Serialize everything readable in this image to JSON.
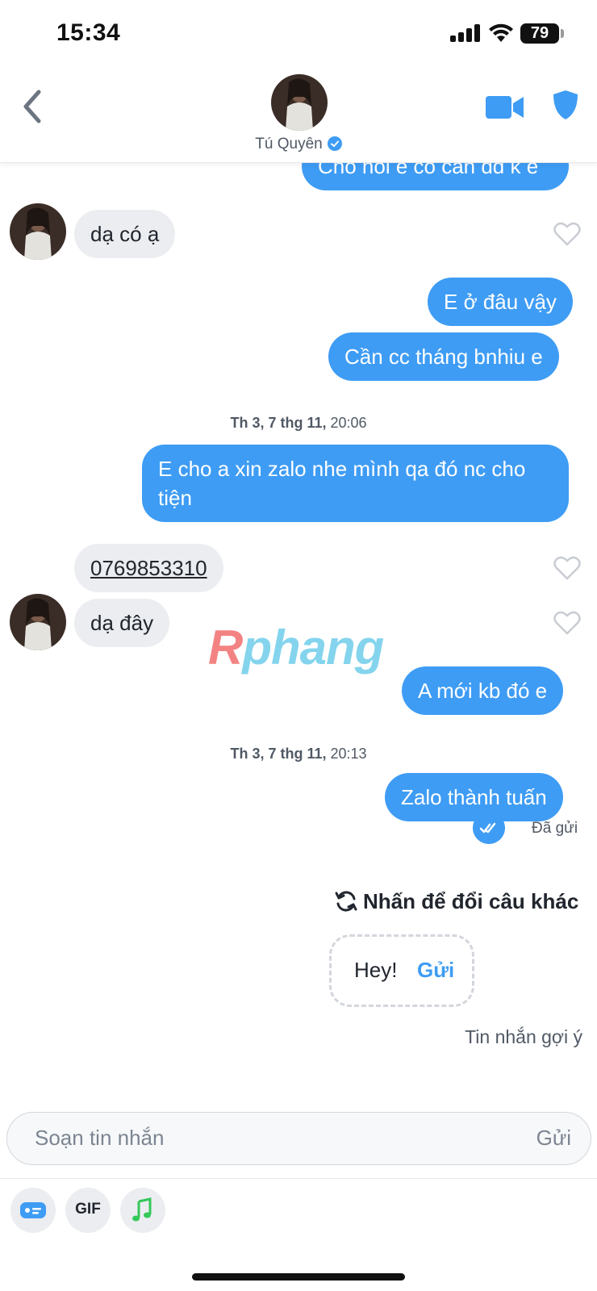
{
  "status_bar": {
    "time": "15:34",
    "battery": "79"
  },
  "header": {
    "contact_name": "Tú Quyên"
  },
  "messages": {
    "m0": "Cho hỏi e có cần dd k e",
    "m1": "dạ có ạ",
    "m2": "E ở đâu vậy",
    "m3": "Cần cc tháng bnhiu e",
    "m4_line1": "E cho a xin zalo nhe mình qa đó nc cho",
    "m4_line2": "tiện",
    "m5": "0769853310",
    "m6": "dạ đây",
    "m7": "A mới kb đó e",
    "m8": "Zalo thành tuấn"
  },
  "timestamps": {
    "t1_day": "Th 3, 7 thg 11,",
    "t1_time": "20:06",
    "t2_day": "Th 3, 7 thg 11,",
    "t2_time": "20:13"
  },
  "watermark": {
    "part_a": "R",
    "part_b": "phang"
  },
  "sent_status": {
    "label": "Đã gửi",
    "plus": "+"
  },
  "suggestions": {
    "swap_label": "Nhấn để đổi câu khác",
    "text": "Hey!",
    "send_label": "Gửi",
    "section_label": "Tin nhắn gợi ý"
  },
  "composer": {
    "placeholder": "Soạn tin nhắn",
    "send_label": "Gửi"
  },
  "toolbar": {
    "gif_label": "GIF"
  },
  "colors": {
    "accent": "#3e9cf4",
    "incoming_bubble": "#ebedf0",
    "music": "#34c759"
  },
  "icons": [
    "back-chevron-icon",
    "verified-icon",
    "video-call-icon",
    "shield-icon",
    "heart-icon",
    "double-check-icon",
    "refresh-icon",
    "sticker-icon",
    "music-note-icon"
  ]
}
